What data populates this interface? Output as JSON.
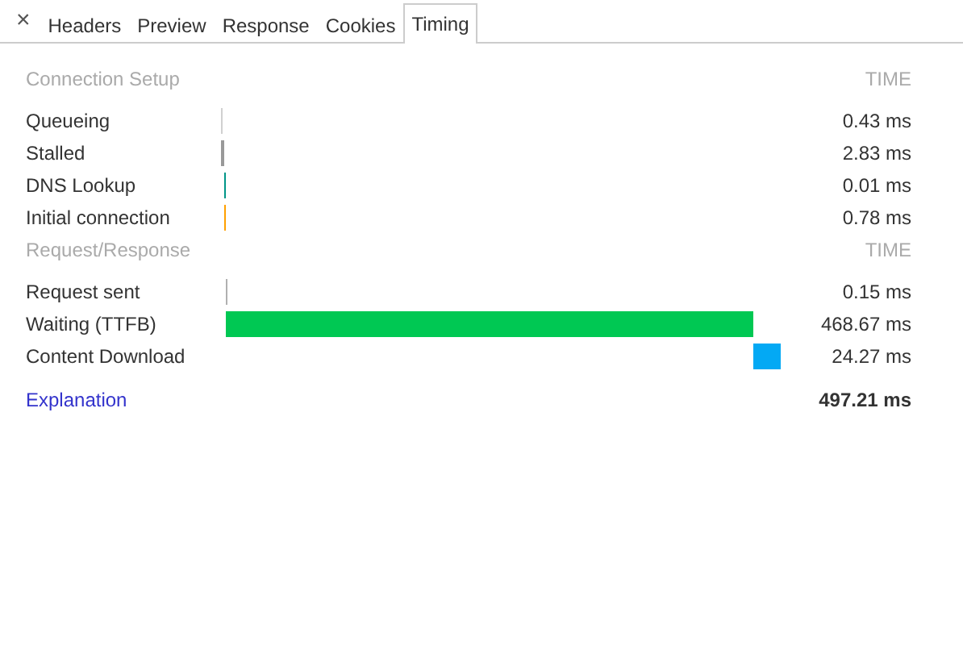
{
  "tabs": [
    {
      "label": "Headers",
      "selected": false
    },
    {
      "label": "Preview",
      "selected": false
    },
    {
      "label": "Response",
      "selected": false
    },
    {
      "label": "Cookies",
      "selected": false
    },
    {
      "label": "Timing",
      "selected": true
    }
  ],
  "close": "×",
  "sections": [
    {
      "title": "Connection Setup",
      "time_heading": "TIME",
      "rows": [
        {
          "label": "Queueing",
          "color": "#d0d0d0",
          "reading": "0.43 ms"
        },
        {
          "label": "Stalled",
          "color": "#999999",
          "reading": "2.83 ms"
        },
        {
          "label": "DNS Lookup",
          "color": "#009688",
          "reading": "0.01 ms"
        },
        {
          "label": "Initial connection",
          "color": "#ffa000",
          "reading": "0.78 ms"
        }
      ]
    },
    {
      "title": "Request/Response",
      "time_heading": "TIME",
      "rows": [
        {
          "label": "Request sent",
          "color": "#b0b0b0",
          "reading": "0.15 ms"
        },
        {
          "label": "Waiting (TTFB)",
          "color": "#00c853",
          "reading": "468.67 ms"
        },
        {
          "label": "Content Download",
          "color": "#03a9f4",
          "reading": "24.27 ms"
        }
      ]
    }
  ],
  "footer": {
    "link": "Explanation",
    "total": "497.21 ms"
  }
}
